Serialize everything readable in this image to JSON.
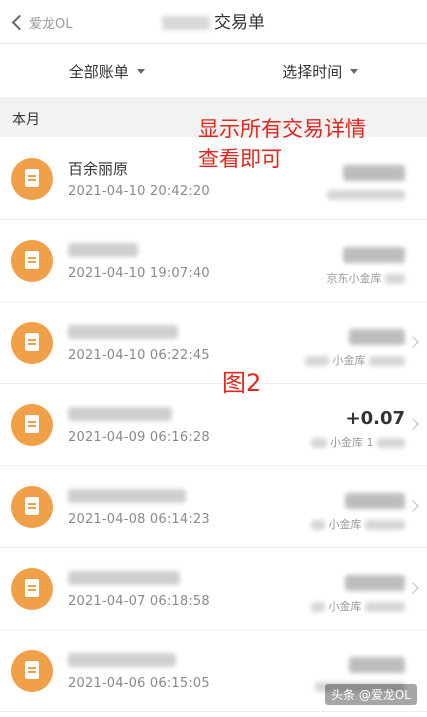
{
  "navbar": {
    "back_watermark": "爱龙OL",
    "title": "交易单"
  },
  "filters": [
    {
      "label": "全部账单"
    },
    {
      "label": "选择时间"
    }
  ],
  "month_label": "本月",
  "annotations": {
    "line1": "显示所有交易详情",
    "line2": "查看即可",
    "figure": "图2"
  },
  "transactions": [
    {
      "name": "百余丽原",
      "time": "2021-04-10  20:42:20",
      "amount": "",
      "sub": ""
    },
    {
      "name": "",
      "time": "2021-04-10  19:07:40",
      "amount": "",
      "sub": "京东小金库"
    },
    {
      "name": "",
      "time": "2021-04-10  06:22:45",
      "amount": "",
      "sub": "小金库"
    },
    {
      "name": "",
      "time": "2021-04-09  06:16:28",
      "amount": "+0.07",
      "sub": "小金库 1"
    },
    {
      "name": "",
      "time": "2021-04-08  06:14:23",
      "amount": "",
      "sub": "小金库"
    },
    {
      "name": "",
      "time": "2021-04-07  06:18:58",
      "amount": "",
      "sub": "小金库"
    },
    {
      "name": "",
      "time": "2021-04-06  06:15:05",
      "amount": "",
      "sub": ""
    }
  ],
  "footer_watermark": "头条 @爱龙OL"
}
